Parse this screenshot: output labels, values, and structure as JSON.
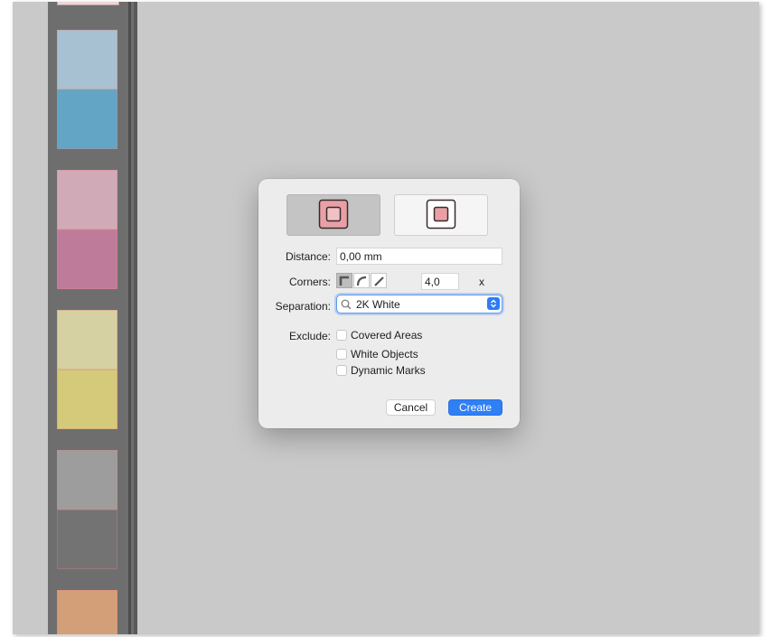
{
  "canvas": {
    "swatch_colors": [
      "#a7c1d3",
      "#62a5c4",
      "#d0abb7",
      "#bf7c9a",
      "#d6d1a2",
      "#d5c97a",
      "#9d9d9d",
      "#737373",
      "#d39f78"
    ]
  },
  "dialog": {
    "mode_icons": {
      "selected": "square-outline-icon",
      "unselected": "square-outline-icon"
    },
    "distance": {
      "label": "Distance:",
      "value": "0,00 mm"
    },
    "corners": {
      "label": "Corners:",
      "options": [
        "corner-sharp-icon",
        "corner-rounded-icon",
        "corner-bevel-icon"
      ],
      "selected": "corner-sharp-icon",
      "value": "4,0",
      "unit": "x"
    },
    "separation": {
      "label": "Separation:",
      "value": "2K White",
      "icon": "magnifier-icon"
    },
    "exclude": {
      "label": "Exclude:",
      "options": [
        {
          "label": "Covered Areas",
          "checked": false
        },
        {
          "label": "White Objects",
          "checked": false
        },
        {
          "label": "Dynamic Marks",
          "checked": false
        }
      ]
    },
    "buttons": {
      "cancel": "Cancel",
      "create": "Create"
    },
    "colors": {
      "accent": "#2f7ff5",
      "selected_icon": "#e8a0a6",
      "icon_stroke": "#3a2a2a"
    }
  }
}
